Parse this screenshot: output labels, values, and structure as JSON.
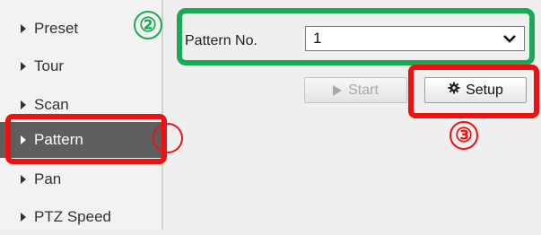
{
  "sidebar": {
    "items": [
      {
        "label": "Preset",
        "active": false
      },
      {
        "label": "Tour",
        "active": false
      },
      {
        "label": "Scan",
        "active": false
      },
      {
        "label": "Pattern",
        "active": true
      },
      {
        "label": "Pan",
        "active": false
      },
      {
        "label": "PTZ Speed",
        "active": false
      }
    ]
  },
  "form": {
    "pattern_label": "Pattern No.",
    "pattern_value": "1"
  },
  "buttons": {
    "start_label": "Start",
    "setup_label": "Setup"
  },
  "annotations": {
    "marker_2": "②",
    "marker_3": "③",
    "green_color": "#1aaa55",
    "red_color": "#ee1111"
  },
  "colors": {
    "active_item_bg": "#5e5e5e",
    "background": "#efefef"
  }
}
